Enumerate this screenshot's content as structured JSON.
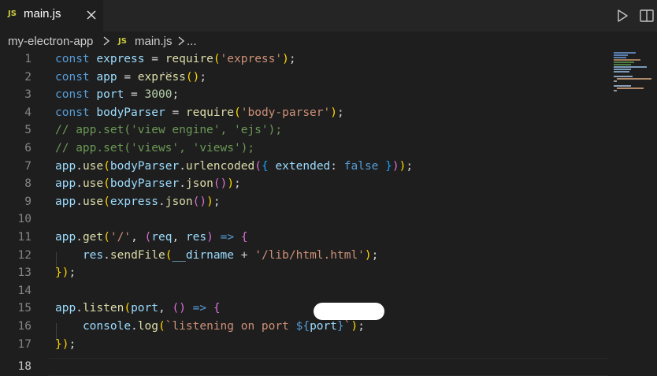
{
  "tab": {
    "icon_text": "JS",
    "label": "main.js",
    "close_icon": "close-icon"
  },
  "actions": {
    "run_icon": "play-icon",
    "split_icon": "split-editor-icon"
  },
  "breadcrumb": {
    "folder": "my-electron-app",
    "file_icon_text": "JS",
    "file": "main.js",
    "more": "..."
  },
  "editor": {
    "line_numbers": [
      "1",
      "2",
      "3",
      "4",
      "5",
      "6",
      "7",
      "8",
      "9",
      "10",
      "11",
      "12",
      "13",
      "14",
      "15",
      "16",
      "17",
      "18"
    ],
    "active_line": 18,
    "lines": [
      "const express = require('express');",
      "const app = express();",
      "const port = 3000;",
      "const bodyParser = require('body-parser');",
      "// app.set('view engine', 'ejs');",
      "// app.set('views', 'views');",
      "app.use(bodyParser.urlencoded({ extended: false }));",
      "app.use(bodyParser.json());",
      "app.use(express.json());",
      "",
      "app.get('/', (req, res) => {",
      "    res.sendFile(__dirname + '/lib/html[redacted].html');",
      "});",
      "",
      "app.listen(port, () => {",
      "    console.log(`listening on port ${port}`);",
      "});",
      ""
    ]
  },
  "colors": {
    "keyword": "#569cd6",
    "variable": "#9cdcfe",
    "function": "#dcdcaa",
    "string": "#ce9178",
    "number": "#b5cea8",
    "comment": "#6a9955",
    "js_icon": "#cbcb41",
    "background": "#1e1e1e"
  }
}
